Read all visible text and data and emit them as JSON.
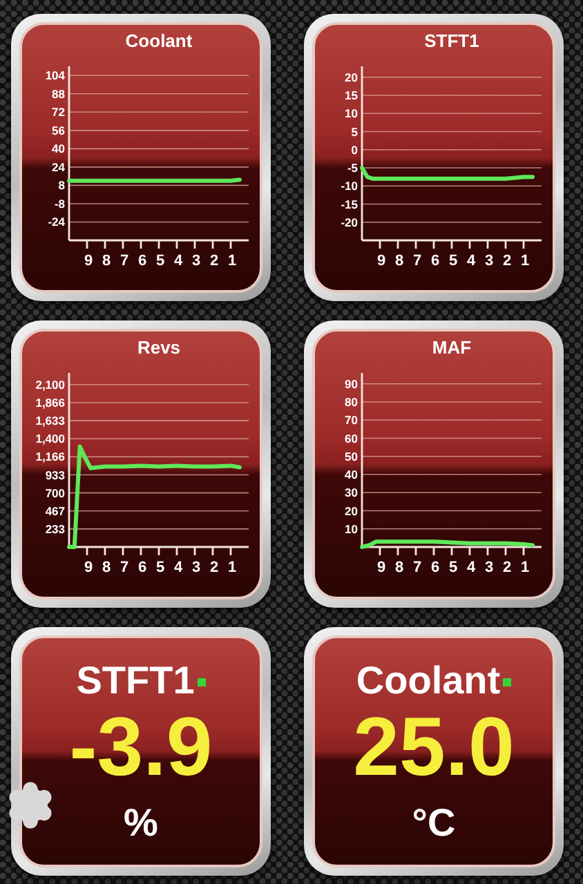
{
  "gauges": [
    {
      "kind": "chart",
      "chart_data": {
        "type": "line",
        "title": "Coolant",
        "x": [
          10,
          9.5,
          9,
          8,
          7,
          6,
          5,
          4,
          3,
          2,
          1,
          0.5
        ],
        "xlim": [
          10,
          0
        ],
        "ylim": [
          -40,
          112
        ],
        "xticks": [
          9,
          8,
          7,
          6,
          5,
          4,
          3,
          2,
          1
        ],
        "yticks": [
          104,
          88,
          72,
          56,
          40,
          24,
          8,
          -8,
          -24
        ],
        "grid": true,
        "series": [
          {
            "color": "#5fe85a",
            "values": [
              12,
              12,
              12,
              12,
              12,
              12,
              12,
              12,
              12,
              12,
              12,
              13
            ]
          }
        ]
      }
    },
    {
      "kind": "chart",
      "chart_data": {
        "type": "line",
        "title": "STFT1",
        "x": [
          10,
          9.7,
          9.4,
          9,
          8,
          7,
          6,
          5,
          4,
          3,
          2,
          1,
          0.5
        ],
        "xlim": [
          10,
          0
        ],
        "ylim": [
          -25,
          23
        ],
        "xticks": [
          9,
          8,
          7,
          6,
          5,
          4,
          3,
          2,
          1
        ],
        "yticks": [
          20,
          15,
          10,
          5,
          0,
          -5,
          -10,
          -15,
          -20
        ],
        "grid": true,
        "series": [
          {
            "color": "#5fe85a",
            "values": [
              -5,
              -7.5,
              -8,
              -8,
              -8,
              -8,
              -8,
              -8,
              -8,
              -8,
              -8,
              -7.5,
              -7.5
            ]
          }
        ]
      }
    },
    {
      "kind": "chart",
      "chart_data": {
        "type": "line",
        "title": "Revs",
        "x": [
          10,
          9.7,
          9.4,
          9.1,
          8.8,
          8,
          7,
          6,
          5,
          4,
          3,
          2,
          1,
          0.5
        ],
        "xlim": [
          10,
          0
        ],
        "ylim": [
          0,
          2250
        ],
        "xticks": [
          9,
          8,
          7,
          6,
          5,
          4,
          3,
          2,
          1
        ],
        "yticks": [
          {
            "value": 2100,
            "label": "2,100"
          },
          {
            "value": 1866,
            "label": "1,866"
          },
          {
            "value": 1633,
            "label": "1,633"
          },
          {
            "value": 1400,
            "label": "1,400"
          },
          {
            "value": 1166,
            "label": "1,166"
          },
          933,
          700,
          467,
          233
        ],
        "grid": true,
        "series": [
          {
            "color": "#5fe85a",
            "values": [
              0,
              0,
              1300,
              1150,
              1020,
              1040,
              1040,
              1050,
              1040,
              1050,
              1040,
              1040,
              1050,
              1030
            ]
          }
        ]
      }
    },
    {
      "kind": "chart",
      "chart_data": {
        "type": "line",
        "title": "MAF",
        "x": [
          10,
          9.6,
          9.2,
          8,
          7,
          6,
          5,
          4,
          3,
          2,
          1,
          0.5
        ],
        "xlim": [
          10,
          0
        ],
        "ylim": [
          0,
          96
        ],
        "xticks": [
          9,
          8,
          7,
          6,
          5,
          4,
          3,
          2,
          1
        ],
        "yticks": [
          90,
          80,
          70,
          60,
          50,
          40,
          30,
          20,
          10
        ],
        "grid": true,
        "series": [
          {
            "color": "#5fe85a",
            "values": [
              0,
              1,
              3,
              3,
              3,
              3,
              2.5,
              2,
              2,
              2,
              1.5,
              1
            ]
          }
        ]
      }
    },
    {
      "kind": "digital",
      "label": "STFT1",
      "value": "-3.9",
      "unit": "%"
    },
    {
      "kind": "digital",
      "label": "Coolant",
      "value": "25.0",
      "unit": "°C"
    }
  ]
}
